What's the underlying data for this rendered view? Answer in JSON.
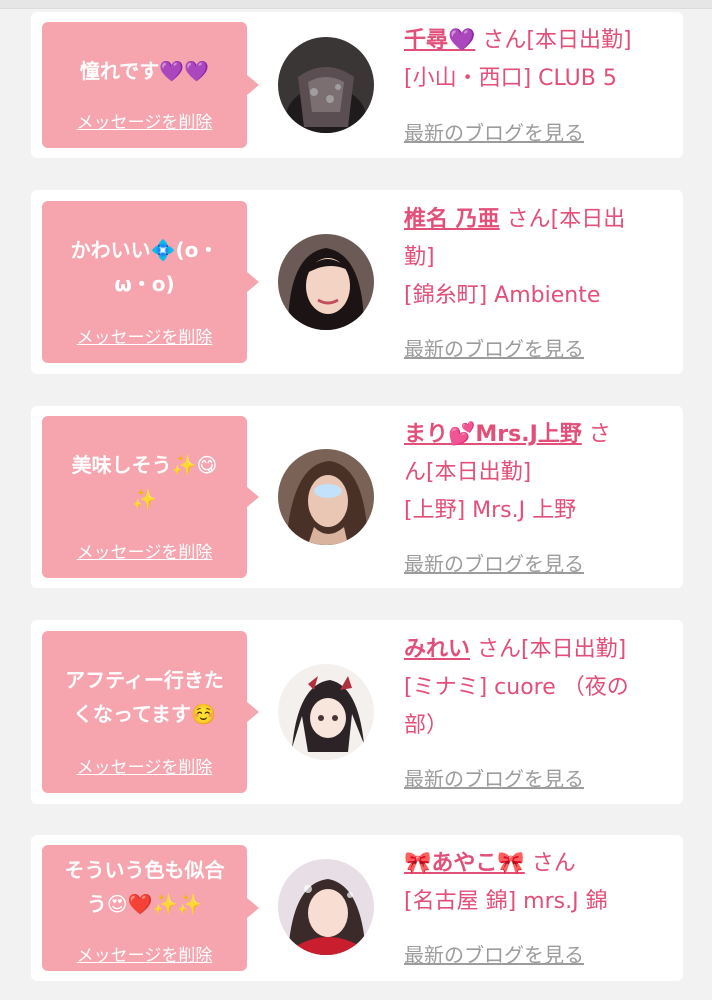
{
  "delete_label": "メッセージを削除",
  "blog_label": "最新のブログを見る",
  "cards": [
    {
      "message": "憧れです💜💜",
      "name": "千尋💜",
      "suffix": "さん[本日出勤]",
      "shop": "[小山・西口] CLUB 5"
    },
    {
      "message_line1": "かわいい💠(o・",
      "message_line2": "ω・o)",
      "name": "椎名 乃亜",
      "suffix_line1": "さん[本日出",
      "suffix_line2": "勤]",
      "shop": "[錦糸町] Ambiente"
    },
    {
      "message_line1": "美味しそう✨😋",
      "message_line2": "✨",
      "name": "まり💕Mrs.J上野",
      "suffix_line1": "さ",
      "suffix_line2": "ん[本日出勤]",
      "shop": "[上野] Mrs.J 上野"
    },
    {
      "message_line1": "アフティー行きた",
      "message_line2": "くなってます☺️",
      "name": "みれい",
      "suffix": "さん[本日出勤]",
      "shop_line1": "[ミナミ] cuore （夜の",
      "shop_line2": "部）"
    },
    {
      "message_line1": "そういう色も似合",
      "message_line2": "う😍❤️✨✨",
      "name": "🎀あやこ🎀",
      "suffix": "さん",
      "shop": "[名古屋 錦] mrs.J 錦"
    }
  ],
  "colors": {
    "bubble": "#f6a4ae",
    "name": "#e24f79",
    "blog_link": "#9c9c9c",
    "background": "#f2f2f2"
  }
}
